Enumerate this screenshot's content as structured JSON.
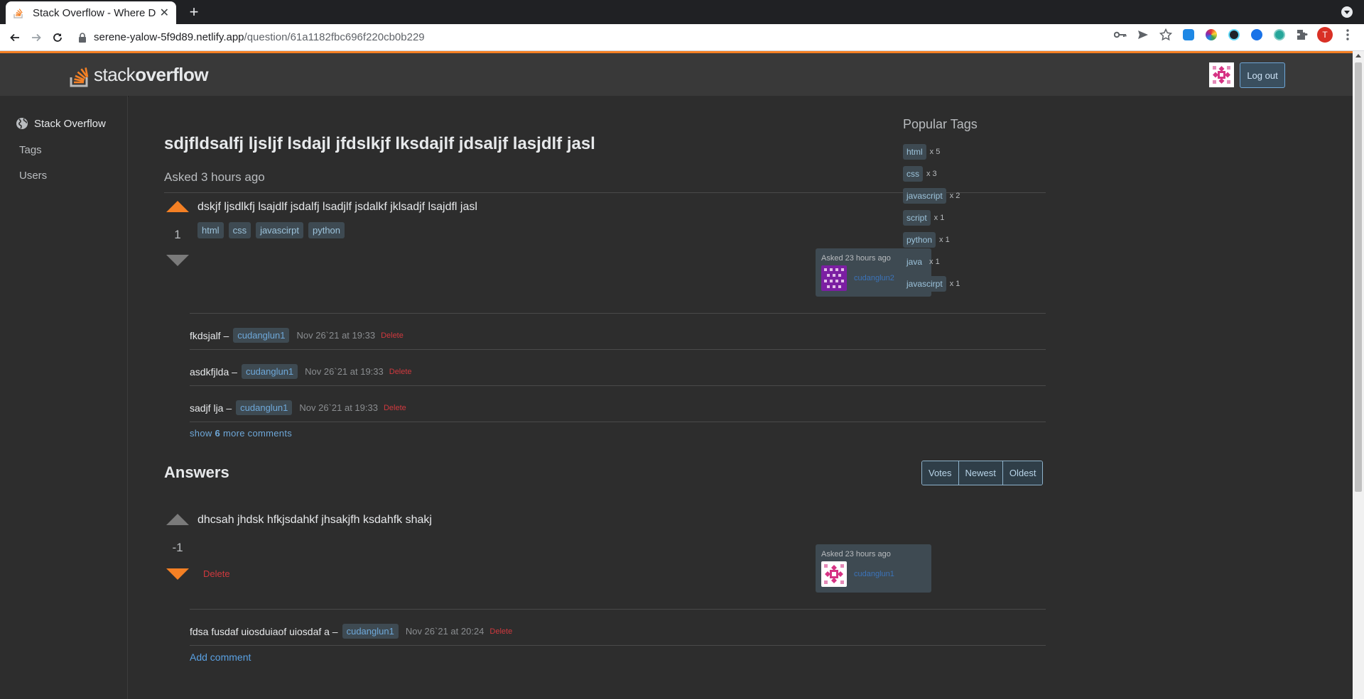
{
  "browser": {
    "tab_title": "Stack Overflow - Where D",
    "url_host": "serene-yalow-5f9d89.netlify.app",
    "url_path": "/question/61a1182fbc696f220cb0b229",
    "profile_initial": "T"
  },
  "header": {
    "logo_light": "stack",
    "logo_bold": "overflow",
    "logout_label": "Log out"
  },
  "sidebar": {
    "items": [
      {
        "label": "Stack Overflow",
        "icon": "globe-icon"
      },
      {
        "label": "Tags"
      },
      {
        "label": "Users"
      }
    ]
  },
  "question": {
    "title": "sdjfldsalfj ljsljf lsdajl jfdslkjf lksdajlf jdsaljf lasjdlf jasl",
    "asked": "Asked 3 hours ago",
    "body": "dskjf ljsdlkfj lsajdlf jsdalfj lsadjlf jsdalkf jklsadjf lsajdfl jasl",
    "votes": "1",
    "tags": [
      "html",
      "css",
      "javascirpt",
      "python"
    ],
    "card": {
      "asked": "Asked 23 hours ago",
      "user": "cudanglun2"
    },
    "comments": [
      {
        "text": "fkdsjalf –",
        "user": "cudanglun1",
        "date": "Nov 26`21 at 19:33",
        "delete": "Delete"
      },
      {
        "text": "asdkfjlda –",
        "user": "cudanglun1",
        "date": "Nov 26`21 at 19:33",
        "delete": "Delete"
      },
      {
        "text": "sadjf lja –",
        "user": "cudanglun1",
        "date": "Nov 26`21 at 19:33",
        "delete": "Delete"
      }
    ],
    "more_comments_prefix": "show",
    "more_comments_count": "6",
    "more_comments_suffix": "more comments"
  },
  "answers": {
    "heading": "Answers",
    "sort": [
      "Votes",
      "Newest",
      "Oldest"
    ],
    "items": [
      {
        "body": "dhcsah jhdsk hfkjsdahkf jhsakjfh ksdahfk shakj",
        "votes": "-1",
        "delete": "Delete",
        "card": {
          "asked": "Asked 23 hours ago",
          "user": "cudanglun1"
        },
        "comments": [
          {
            "text": "fdsa fusdaf uiosduiaof uiosdaf a –",
            "user": "cudanglun1",
            "date": "Nov 26`21 at 20:24",
            "delete": "Delete"
          }
        ],
        "add_comment": "Add comment"
      }
    ]
  },
  "popular_tags": {
    "title": "Popular Tags",
    "items": [
      {
        "name": "html",
        "count": "x 5"
      },
      {
        "name": "css",
        "count": "x 3"
      },
      {
        "name": "javascript",
        "count": "x 2"
      },
      {
        "name": "script",
        "count": "x 1"
      },
      {
        "name": "python",
        "count": "x 1"
      },
      {
        "name": "java",
        "count": "x 1"
      },
      {
        "name": "javascirpt",
        "count": "x 1"
      }
    ]
  },
  "colors": {
    "accent": "#f48024",
    "background": "#2d2d2d",
    "header": "#393939",
    "tag_bg": "#3e4a52",
    "tag_text": "#9cc3db",
    "delete": "#d0393e",
    "link": "#5aa1e3"
  }
}
